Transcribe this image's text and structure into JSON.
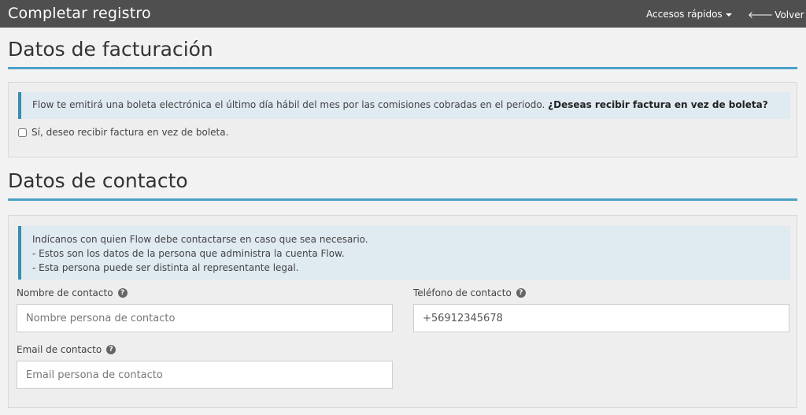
{
  "header": {
    "title": "Completar registro",
    "quick_access_label": "Accesos rápidos",
    "back_label": "Volver"
  },
  "billing": {
    "heading": "Datos de facturación",
    "info_text": "Flow te emitirá una boleta electrónica el último día hábil del mes por las comisiones cobradas en el periodo. ",
    "info_question": "¿Deseas recibir factura en vez de boleta?",
    "checkbox_label": "Sí, deseo recibir factura en vez de boleta.",
    "checkbox_checked": false
  },
  "contact": {
    "heading": "Datos de contacto",
    "info_lines": [
      "Indícanos con quien Flow debe contactarse en caso que sea necesario.",
      "- Estos son los datos de la persona que administra la cuenta Flow.",
      "- Esta persona puede ser distinta al representante legal."
    ],
    "fields": {
      "name": {
        "label": "Nombre de contacto",
        "value": "",
        "placeholder": "Nombre persona de contacto"
      },
      "phone": {
        "label": "Teléfono de contacto",
        "value": "+56912345678",
        "placeholder": ""
      },
      "email": {
        "label": "Email de contacto",
        "value": "",
        "placeholder": "Email persona de contacto"
      }
    }
  },
  "icons": {
    "help": "question-circle-icon",
    "back": "arrow-left-icon",
    "dropdown": "caret-down-icon"
  },
  "colors": {
    "topbar": "#4f4f4f",
    "accent": "#4aa0c8",
    "info_background": "#dfeaf1",
    "info_border": "#3a8cb3"
  }
}
